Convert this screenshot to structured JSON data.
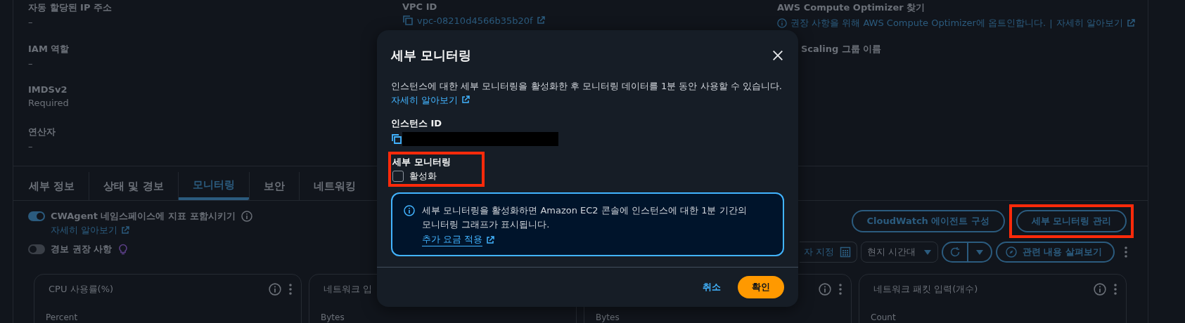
{
  "details": [
    [
      {
        "kind": "text",
        "label": "자동 할당된 IP 주소",
        "value": "–"
      },
      {
        "kind": "text",
        "label": "IAM 역할",
        "value": "–"
      },
      {
        "kind": "text",
        "label": "IMDSv2",
        "value": "Required"
      },
      {
        "kind": "text",
        "label": "연산자",
        "value": "–"
      }
    ],
    [
      {
        "kind": "copy_link",
        "label": "VPC ID",
        "link": "vpc-08210d4566b35b20f"
      }
    ],
    [
      {
        "kind": "notice",
        "label": "AWS Compute Optimizer 찾기",
        "notice": "권장 사항을 위해 AWS Compute Optimizer에 옵트인합니다.",
        "separator": "|",
        "link": "자세히 알아보기"
      },
      {
        "kind": "clipped",
        "label": "Scaling 그룹 이름"
      }
    ]
  ],
  "tabs": [
    {
      "label": "세부 정보",
      "selected": false
    },
    {
      "label": "상태 및 경보",
      "selected": false
    },
    {
      "label": "모니터링",
      "selected": true
    },
    {
      "label": "보안",
      "selected": false
    },
    {
      "label": "네트워킹",
      "selected": false
    }
  ],
  "toggles": [
    {
      "label": "CWAgent 네임스페이스에 지표 포함시키기",
      "on": true,
      "link": "자세히 알아보기"
    },
    {
      "label": "경보 권장 사항",
      "on": false
    }
  ],
  "action_buttons": [
    {
      "label": "CloudWatch 에이전트 구성",
      "highlighted": false
    },
    {
      "label": "세부 모니터링 관리",
      "highlighted": true
    }
  ],
  "toolbar": {
    "date_range": "자 지정",
    "timezone": "현지 시간대",
    "explore": "관련 내용 살펴보기"
  },
  "charts": [
    {
      "title": "CPU 사용률(%)",
      "unit": "Percent",
      "controls": true
    },
    {
      "title": "네트워크 입",
      "unit": "Bytes"
    },
    {
      "unit": "Bytes",
      "controls": true
    },
    {
      "title": "네트워크 패킷 입력(개수)",
      "unit": "Count",
      "controls": true
    }
  ],
  "modal": {
    "title": "세부 모니터링",
    "description": "인스턴스에 대한 세부 모니터링을 활성화한 후 모니터링 데이터를 1분 동안 사용할 수 있습니다.",
    "description_link": "자세히 알아보기",
    "instance_id_label": "인스턴스 ID",
    "monitoring": {
      "label": "세부 모니터링",
      "option": "활성화",
      "checked": false,
      "highlighted": true
    },
    "info": {
      "text": "세부 모니터링을 활성화하면 Amazon EC2 콘솔에 인스턴스에 대한 1분 기간의 모니터링 그래프가 표시됩니다.",
      "link": "추가 요금 적용"
    },
    "cancel": "취소",
    "confirm": "확인"
  }
}
